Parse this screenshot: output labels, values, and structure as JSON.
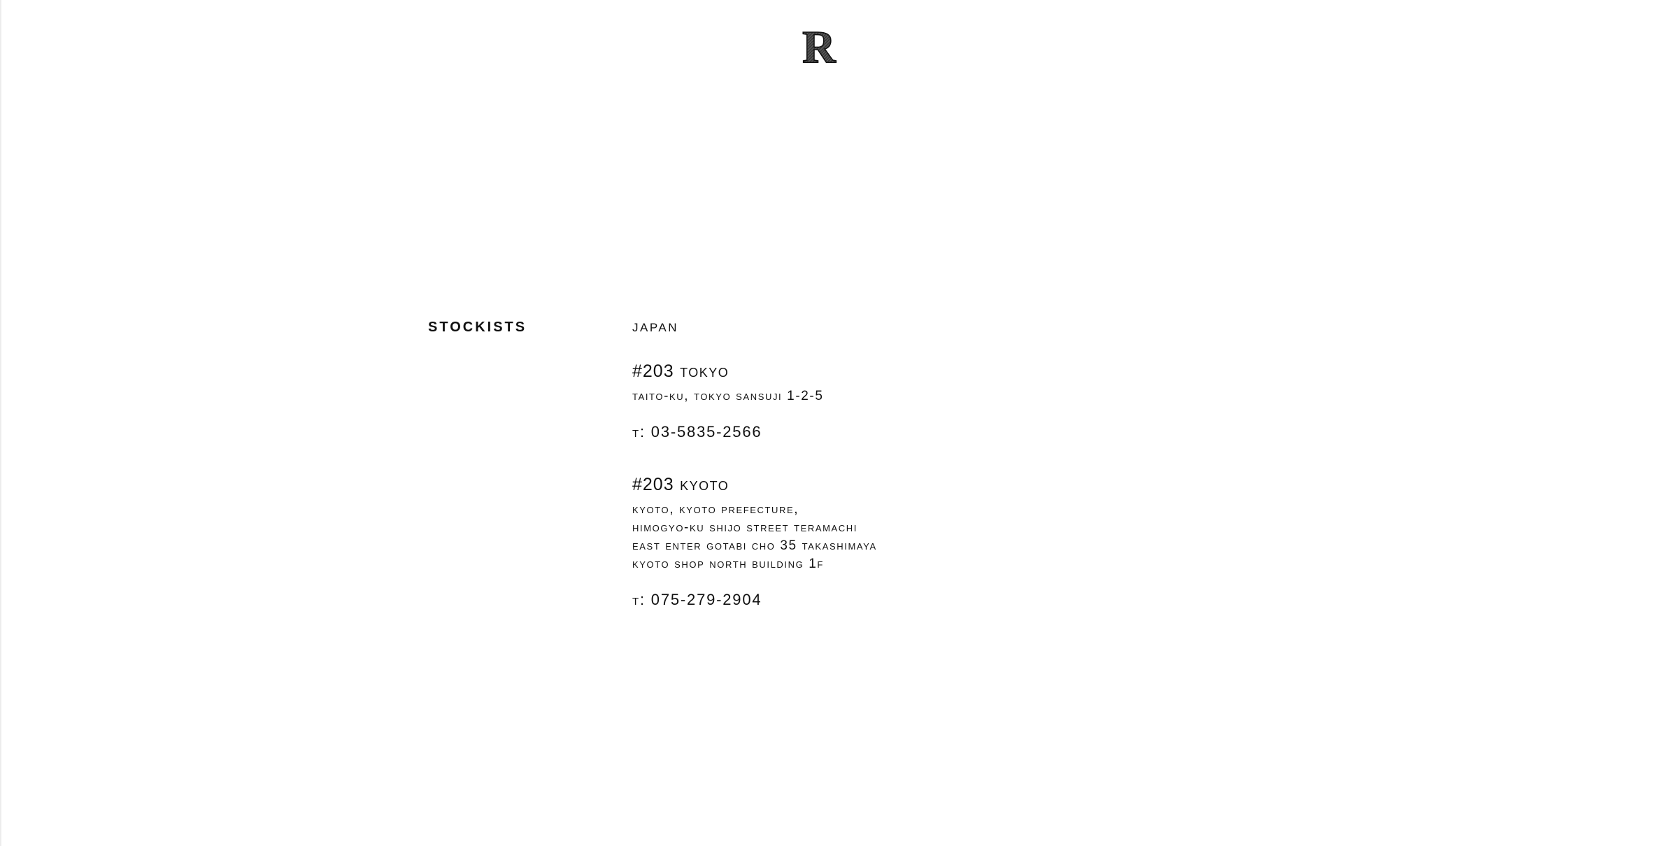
{
  "header": {
    "logo_icon": "r-monogram-icon",
    "logo_letter": "R"
  },
  "section": {
    "title": "STOCKISTS"
  },
  "region": {
    "country": "JAPAN"
  },
  "stores": [
    {
      "number": "#203",
      "city": "TOKYO",
      "address": [
        "TAITO-KU, TOKYO SANSUJI 1-2-5"
      ],
      "phone_label": "T:",
      "phone": "03-5835-2566"
    },
    {
      "number": "#203",
      "city": "KYOTO",
      "address": [
        "KYOTO, KYOTO PREFECTURE,",
        "HIMOGYO-KU SHIJO STREET TERAMACHI",
        "EAST ENTER GOTABI CHO 35 TAKASHIMAYA",
        "KYOTO SHOP NORTH BUILDING 1F"
      ],
      "phone_label": "T:",
      "phone": "075-279-2904"
    }
  ],
  "colors": {
    "background": "#ffffff",
    "text": "#111111"
  }
}
